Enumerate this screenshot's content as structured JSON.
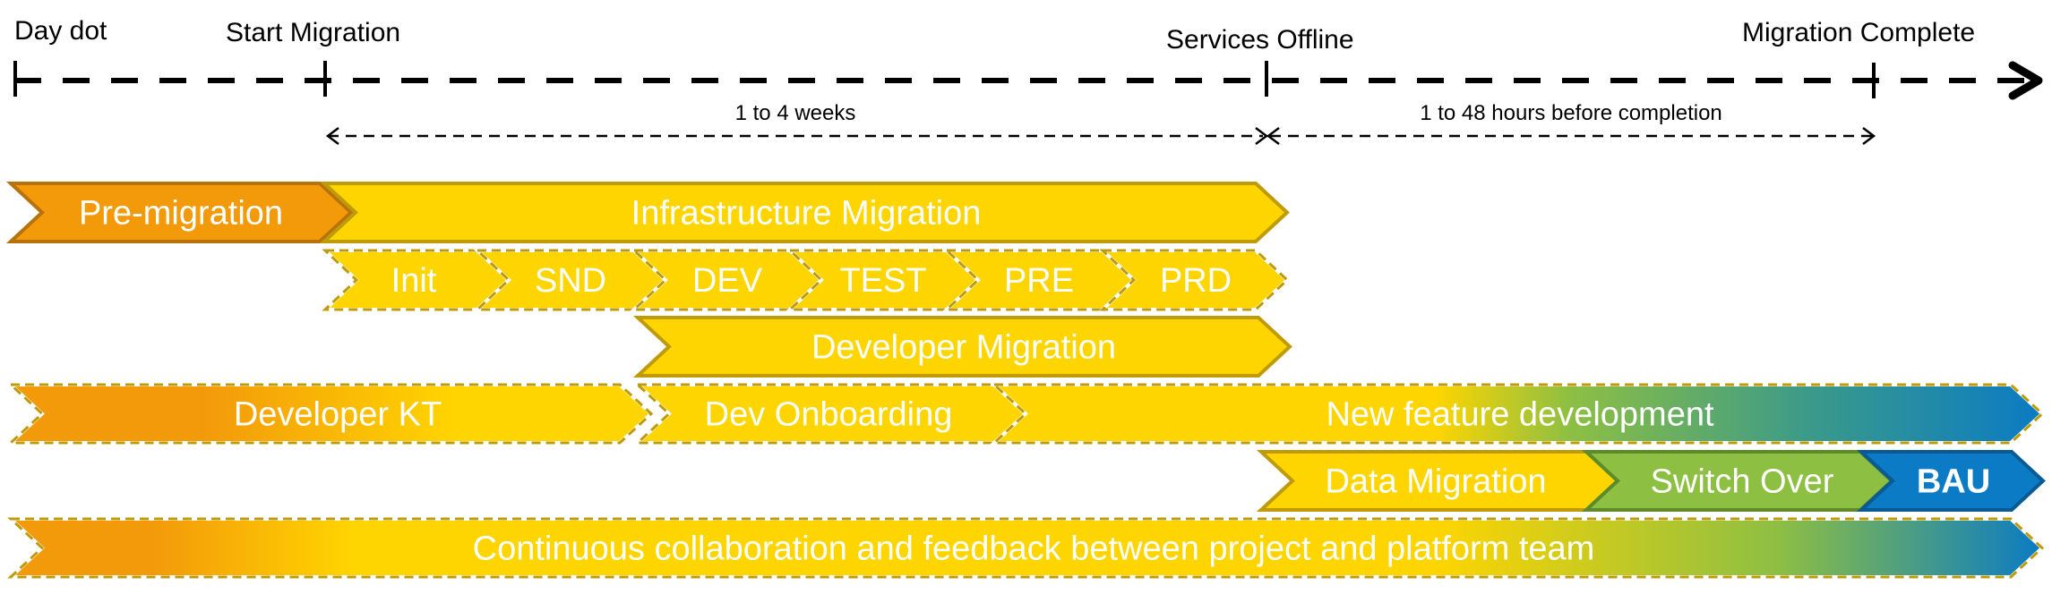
{
  "milestones": [
    {
      "id": "day-dot",
      "label": "Day dot"
    },
    {
      "id": "start-migration",
      "label": "Start Migration"
    },
    {
      "id": "services-offline",
      "label": "Services Offline"
    },
    {
      "id": "migration-complete",
      "label": "Migration Complete"
    }
  ],
  "durations": [
    {
      "id": "infra-window",
      "label": "1 to 4 weeks"
    },
    {
      "id": "offline-window",
      "label": "1 to 48 hours before completion"
    }
  ],
  "colors": {
    "orange": "#F39A0A",
    "orange_border": "#B8720B",
    "yellow": "#FFD500",
    "yellow_border": "#BF9B0A",
    "green": "#8DBF43",
    "green_border": "#5F8A2A",
    "blue": "#0A7BC4",
    "blue_border": "#0A5A94",
    "timeline": "#000000"
  },
  "bars": [
    {
      "id": "pre-migration",
      "label": "Pre-migration",
      "fill": "orange",
      "style": "solid"
    },
    {
      "id": "infrastructure-migration",
      "label": "Infrastructure Migration",
      "fill": "yellow",
      "style": "solid"
    },
    {
      "id": "step-init",
      "label": "Init",
      "fill": "yellow",
      "style": "dashed"
    },
    {
      "id": "step-snd",
      "label": "SND",
      "fill": "yellow",
      "style": "dashed"
    },
    {
      "id": "step-dev",
      "label": "DEV",
      "fill": "yellow",
      "style": "dashed"
    },
    {
      "id": "step-test",
      "label": "TEST",
      "fill": "yellow",
      "style": "dashed"
    },
    {
      "id": "step-pre",
      "label": "PRE",
      "fill": "yellow",
      "style": "dashed"
    },
    {
      "id": "step-prd",
      "label": "PRD",
      "fill": "yellow",
      "style": "dashed"
    },
    {
      "id": "developer-migration",
      "label": "Developer Migration",
      "fill": "yellow",
      "style": "solid"
    },
    {
      "id": "developer-kt",
      "label": "Developer KT",
      "fill": "grad-kt",
      "style": "dashed"
    },
    {
      "id": "dev-onboarding",
      "label": "Dev Onboarding",
      "fill": "yellow",
      "style": "dashed"
    },
    {
      "id": "new-feature-development",
      "label": "New feature development",
      "fill": "grad-nfd",
      "style": "dashed"
    },
    {
      "id": "data-migration",
      "label": "Data Migration",
      "fill": "yellow",
      "style": "solid"
    },
    {
      "id": "switch-over",
      "label": "Switch Over",
      "fill": "green",
      "style": "solid"
    },
    {
      "id": "bau",
      "label": "BAU",
      "fill": "blue",
      "style": "solid",
      "bold": true
    },
    {
      "id": "continuous-collaboration",
      "label": "Continuous collaboration and feedback between project and platform team",
      "fill": "grad-cc",
      "style": "dashed"
    }
  ]
}
